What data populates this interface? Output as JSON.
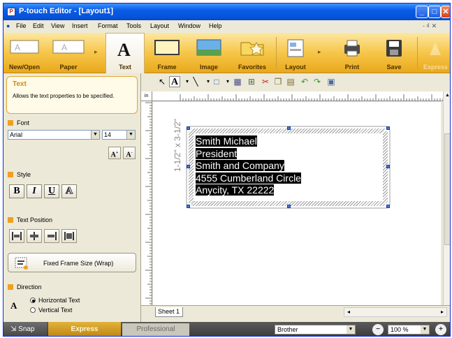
{
  "window": {
    "title": "P-touch Editor - [Layout1]",
    "controls": {
      "minimize": "_",
      "maximize": "□",
      "close": "✕"
    },
    "mdi_controls": "- ₫ ✕"
  },
  "menu": [
    {
      "label": "File"
    },
    {
      "label": "Edit"
    },
    {
      "label": "View"
    },
    {
      "label": "Insert"
    },
    {
      "label": "Format"
    },
    {
      "label": "Tools"
    },
    {
      "label": "Layout"
    },
    {
      "label": "Window"
    },
    {
      "label": "Help"
    }
  ],
  "toolbar": {
    "new_open": "New/Open",
    "paper": "Paper",
    "text": "Text",
    "frame": "Frame",
    "image": "Image",
    "favorites": "Favorites",
    "layout": "Layout",
    "print": "Print",
    "save": "Save",
    "express": "Express"
  },
  "sidepanel": {
    "title": "Text",
    "description": "Allows the text properties to be specified.",
    "font_section": "Font",
    "font_name": "Arial",
    "font_size": "14",
    "style_section": "Style",
    "style_bold": "B",
    "style_italic": "I",
    "style_underline": "U",
    "style_outline": "A",
    "grow_font": "A",
    "shrink_font": "A",
    "position_section": "Text Position",
    "fixed_frame": "Fixed Frame Size (Wrap)",
    "direction_section": "Direction",
    "horizontal_text": "Horizontal Text",
    "vertical_text": "Vertical Text",
    "direction_icon": "A"
  },
  "canvas": {
    "label_lines": [
      "Smith Michael",
      "President",
      "Smith and Company",
      "4555 Cumberland Circle",
      "Anycity, TX  22222"
    ],
    "dimension": "1-1/2\" x 3-1/2\"",
    "ruler_unit": "in"
  },
  "sheet": {
    "tab": "Sheet 1"
  },
  "statusbar": {
    "snap": "Snap",
    "express": "Express",
    "professional": "Professional",
    "printer": "Brother",
    "zoom": "100 %"
  },
  "colors": {
    "accent": "#f0a020",
    "title_blue": "#0a5ce6"
  }
}
